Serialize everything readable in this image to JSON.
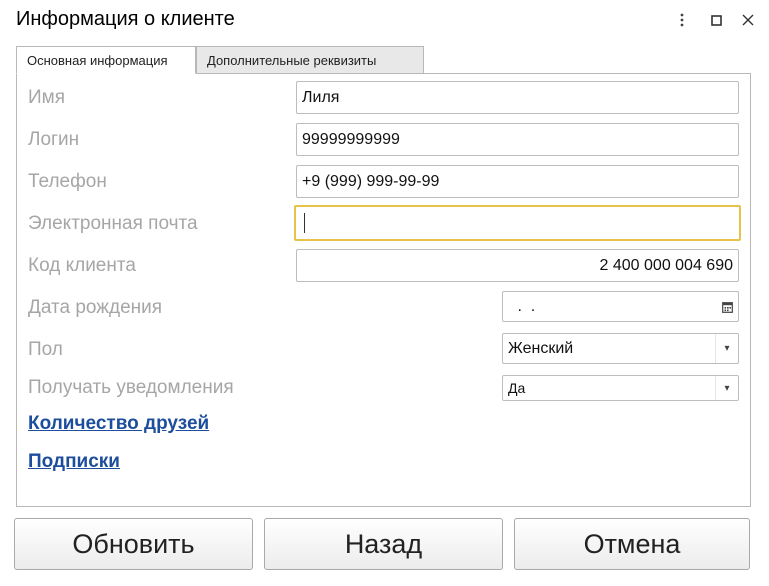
{
  "window": {
    "title": "Информация о клиенте",
    "more_icon": "more-vertical-icon",
    "maximize_icon": "maximize-icon",
    "close_icon": "close-icon"
  },
  "tabs": [
    {
      "label": "Основная информация",
      "active": true
    },
    {
      "label": "Дополнительные реквизиты",
      "active": false
    }
  ],
  "form": {
    "name": {
      "label": "Имя",
      "value": "Лиля"
    },
    "login": {
      "label": "Логин",
      "value": "99999999999"
    },
    "phone": {
      "label": "Телефон",
      "value": "+9 (999) 999-99-99"
    },
    "email": {
      "label": "Электронная почта",
      "value": ""
    },
    "client_code": {
      "label": "Код клиента",
      "value": "2 400 000 004 690"
    },
    "birth_date": {
      "label": "Дата рождения",
      "value": " .  ."
    },
    "gender": {
      "label": "Пол",
      "value": "Женский"
    },
    "notifications": {
      "label": "Получать уведомления",
      "value": "Да"
    }
  },
  "links": {
    "friends": "Количество друзей",
    "subscriptions": "Подписки"
  },
  "buttons": {
    "refresh": "Обновить",
    "back": "Назад",
    "cancel": "Отмена"
  },
  "colors": {
    "focus_border": "#e6c34a",
    "link": "#1c4e9c",
    "label": "#a6a6a6"
  }
}
